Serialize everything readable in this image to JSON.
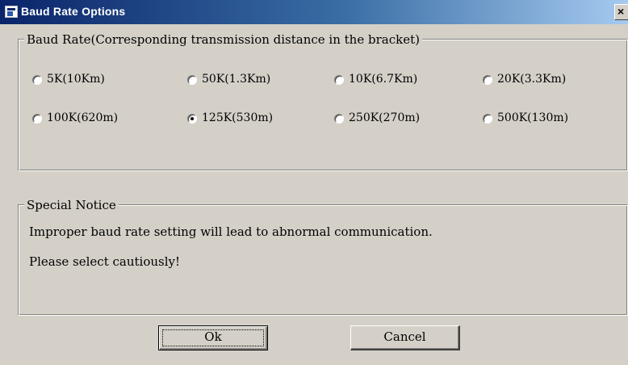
{
  "window": {
    "title": "Baud Rate Options",
    "close_glyph": "×"
  },
  "baud_group": {
    "legend": "Baud Rate(Corresponding transmission distance in the bracket)",
    "options": [
      {
        "label": "5K(10Km)",
        "selected": false
      },
      {
        "label": "50K(1.3Km)",
        "selected": false
      },
      {
        "label": "10K(6.7Km)",
        "selected": false
      },
      {
        "label": "20K(3.3Km)",
        "selected": false
      },
      {
        "label": "100K(620m)",
        "selected": false
      },
      {
        "label": "125K(530m)",
        "selected": true
      },
      {
        "label": "250K(270m)",
        "selected": false
      },
      {
        "label": "500K(130m)",
        "selected": false
      }
    ]
  },
  "notice_group": {
    "legend": "Special Notice",
    "line1": "Improper baud rate setting will lead to abnormal communication.",
    "line2": "Please select cautiously!"
  },
  "buttons": {
    "ok_label": "Ok",
    "cancel_label": "Cancel"
  },
  "colors": {
    "titlebar_start": "#0a246a",
    "titlebar_end": "#a6caf0",
    "face": "#d4d0c8"
  },
  "icons": {
    "title_icon": "app-window-icon",
    "close_icon": "close-icon"
  }
}
